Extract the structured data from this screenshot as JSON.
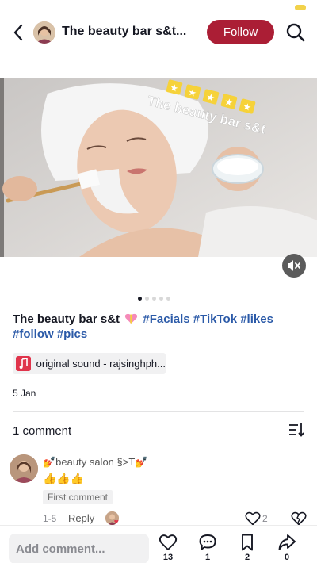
{
  "header": {
    "title": "The beauty bar s&t...",
    "follow_label": "Follow"
  },
  "media": {
    "overlay_text": "The beauty bar s&t",
    "stars": [
      "★",
      "★",
      "★",
      "★",
      "★"
    ],
    "slide_count": 5,
    "active_slide": 0
  },
  "post": {
    "caption_prefix": "The beauty bar s&t",
    "hashtags_line1": "#Facials #TikTok #likes",
    "hashtags_line2": "#follow #pics",
    "sound": "original sound - rajsinghph...",
    "date": "5 Jan"
  },
  "comments": {
    "count_label": "1 comment",
    "items": [
      {
        "username": "💅beauty salon §>T💅",
        "text": "👍👍👍",
        "badge": "First comment",
        "index": "1-5",
        "reply_label": "Reply",
        "likes": "2"
      }
    ]
  },
  "bottom_bar": {
    "placeholder": "Add comment...",
    "likes": "13",
    "comments": "1",
    "saves": "2",
    "shares": "0"
  },
  "colors": {
    "follow_bg": "#ab1e35",
    "hashtag": "#2b5aa8",
    "music_icon": "#e0344b",
    "star_bg": "#f6d23a"
  }
}
